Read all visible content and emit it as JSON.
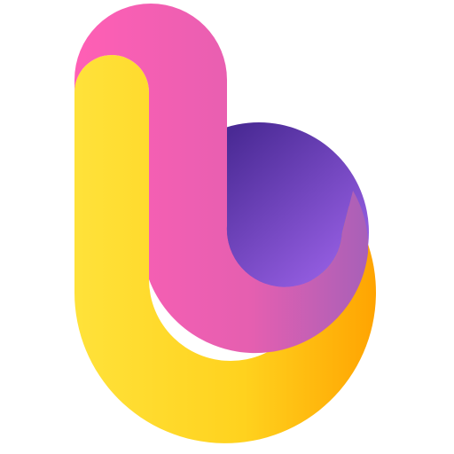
{
  "logo": {
    "name": "b-letter-logo",
    "colors": {
      "yellow": "#FFE23A",
      "orange": "#FFA200",
      "pink": "#FF5FB5",
      "magenta": "#B860B8",
      "purple_dark": "#4A2A95",
      "purple_light": "#9B62E8"
    }
  }
}
